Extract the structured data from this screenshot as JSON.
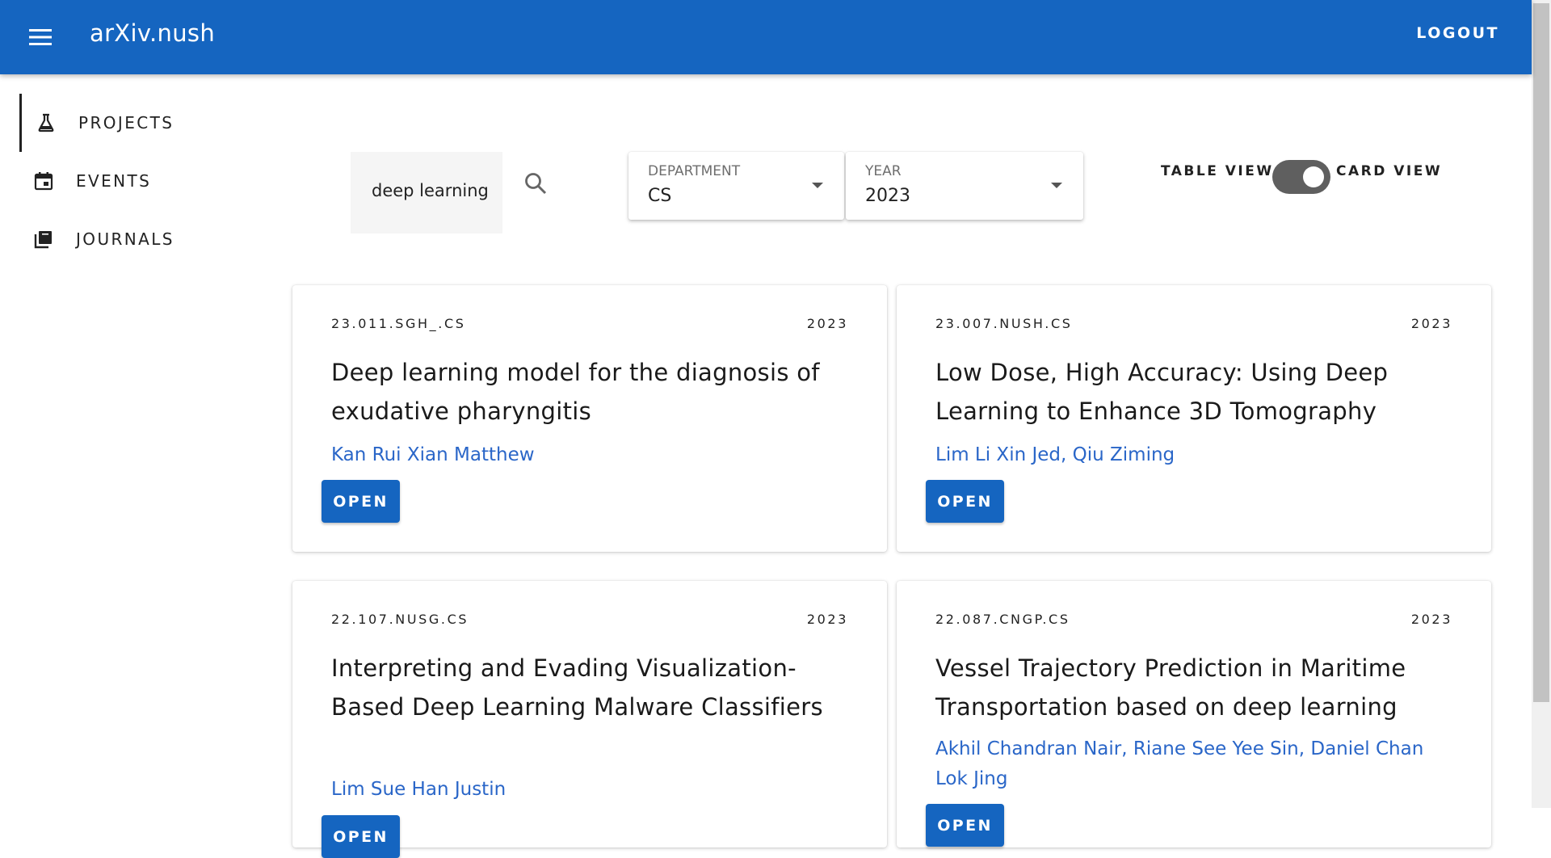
{
  "app": {
    "title": "arXiv.nush",
    "logout_label": "LOGOUT"
  },
  "sidebar": {
    "items": [
      {
        "label": "PROJECTS",
        "icon": "flask-icon",
        "active": true
      },
      {
        "label": "EVENTS",
        "icon": "calendar-icon",
        "active": false
      },
      {
        "label": "JOURNALS",
        "icon": "library-books-icon",
        "active": false
      }
    ]
  },
  "search": {
    "value": "deep learning",
    "icon": "search-icon"
  },
  "filters": {
    "department": {
      "label": "DEPARTMENT",
      "value": "CS"
    },
    "year": {
      "label": "YEAR",
      "value": "2023"
    }
  },
  "view_toggle": {
    "left_label": "TABLE VIEW",
    "right_label": "CARD VIEW",
    "state": "card"
  },
  "cards": [
    {
      "id": "23.011.SGH_.CS",
      "year": "2023",
      "title": "Deep learning model for the diagnosis of exudative pharyngitis",
      "authors": [
        "Kan Rui Xian Matthew"
      ],
      "open_label": "OPEN"
    },
    {
      "id": "23.007.NUSH.CS",
      "year": "2023",
      "title": "Low Dose, High Accuracy: Using Deep Learning to Enhance 3D Tomography",
      "authors": [
        "Lim Li Xin Jed",
        "Qiu Ziming"
      ],
      "open_label": "OPEN"
    },
    {
      "id": "22.107.NUSG.CS",
      "year": "2023",
      "title": "Interpreting and Evading Visualization-Based Deep Learning Malware Classifiers",
      "authors": [
        "Lim Sue Han Justin"
      ],
      "open_label": "OPEN"
    },
    {
      "id": "22.087.CNGP.CS",
      "year": "2023",
      "title": "Vessel Trajectory Prediction in Maritime Transportation based on deep learning",
      "authors": [
        "Akhil Chandran Nair",
        "Riane See Yee Sin",
        "Daniel Chan Lok Jing"
      ],
      "open_label": "OPEN"
    }
  ],
  "colors": {
    "primary": "#1565c0",
    "link": "#2a66c8",
    "switch_track": "#5f5f5f"
  }
}
